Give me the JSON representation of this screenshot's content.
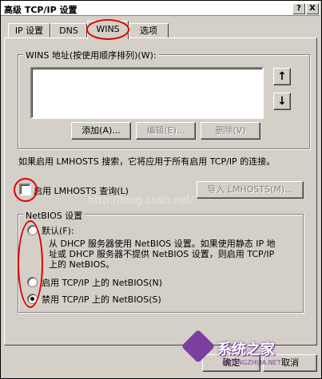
{
  "window": {
    "title": "高级 TCP/IP 设置",
    "help_label": "?",
    "close_label": "X"
  },
  "tabs": [
    {
      "label": "IP 设置"
    },
    {
      "label": "DNS"
    },
    {
      "label": "WINS"
    },
    {
      "label": "选项"
    }
  ],
  "wins": {
    "group_label": "WINS 地址(按使用顺序排列)(W):",
    "add_label": "添加(A)...",
    "edit_label": "编辑(E)...",
    "delete_label": "删除(V)",
    "up_label": "↑",
    "down_label": "↓"
  },
  "lmhosts": {
    "info_text": "如果启用 LMHOSTS 搜索，它将应用于所有启用 TCP/IP 的连接。",
    "checkbox_label": "启用 LMHOSTS 查询(L)",
    "checked": false,
    "import_label": "导入 LMHOSTS(M)..."
  },
  "netbios": {
    "group_label": "NetBIOS 设置",
    "options": [
      {
        "label": "默认(F):",
        "selected": false
      },
      {
        "label": "启用 TCP/IP 上的 NetBIOS(N)",
        "selected": false
      },
      {
        "label": "禁用 TCP/IP 上的 NetBIOS(S)",
        "selected": true
      }
    ],
    "description_lines": [
      "从 DHCP 服务器使用 NetBIOS 设置。如果使用静态 IP 地",
      "址或 DHCP 服务器不提供 NetBIOS 设置，则启用 TCP/IP",
      "上的 NetBIOS。"
    ]
  },
  "footer": {
    "ok_label": "确定",
    "cancel_label": "取消"
  },
  "overlay": {
    "watermark_text": "http://blog.csdn.net/",
    "brand_text": "系统之家",
    "brand_url": "XITONGZHIJIA.NET"
  },
  "colors": {
    "annotation": "#e00000",
    "face": "#d4d0c8"
  }
}
